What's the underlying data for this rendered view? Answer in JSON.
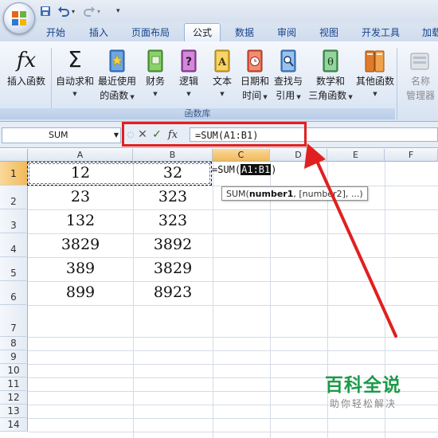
{
  "quick_access": {
    "save": "save-icon",
    "undo": "undo-icon",
    "redo": "redo-icon",
    "customize": "dropdown-icon"
  },
  "tabs": [
    {
      "label": "开始",
      "active": false
    },
    {
      "label": "插入",
      "active": false
    },
    {
      "label": "页面布局",
      "active": false
    },
    {
      "label": "公式",
      "active": true
    },
    {
      "label": "数据",
      "active": false
    },
    {
      "label": "审阅",
      "active": false
    },
    {
      "label": "视图",
      "active": false
    },
    {
      "label": "开发工具",
      "active": false
    },
    {
      "label": "加载",
      "active": false
    }
  ],
  "ribbon": {
    "insert_function": {
      "line1": "插入函数"
    },
    "autosum": {
      "line1": "自动求和"
    },
    "recent": {
      "line1": "最近使用",
      "line2": "的函数"
    },
    "financial": {
      "line1": "财务"
    },
    "logical": {
      "line1": "逻辑"
    },
    "text": {
      "line1": "文本"
    },
    "datetime": {
      "line1": "日期和",
      "line2": "时间"
    },
    "lookup": {
      "line1": "查找与",
      "line2": "引用"
    },
    "math": {
      "line1": "数学和",
      "line2": "三角函数"
    },
    "more": {
      "line1": "其他函数"
    },
    "name_manager": {
      "line1": "名称",
      "line2": "管理器"
    },
    "group_label": "函数库"
  },
  "formula_bar": {
    "name_box": "SUM",
    "formula": "=SUM(A1:B1)",
    "fx": "fx"
  },
  "columns": [
    "A",
    "B",
    "C",
    "D",
    "E",
    "F"
  ],
  "rows": [
    "1",
    "2",
    "3",
    "4",
    "5",
    "6",
    "7",
    "8",
    "9",
    "10",
    "11",
    "12",
    "13",
    "14"
  ],
  "cells": [
    {
      "a": "12",
      "b": "32"
    },
    {
      "a": "23",
      "b": "323"
    },
    {
      "a": "132",
      "b": "323"
    },
    {
      "a": "3829",
      "b": "3892"
    },
    {
      "a": "389",
      "b": "3829"
    },
    {
      "a": "899",
      "b": "8923"
    }
  ],
  "editing": {
    "prefix": "=SUM(",
    "range": "A1:B1",
    "suffix": ")"
  },
  "tooltip": {
    "fn": "SUM(",
    "arg1": "number1",
    "rest": ", [number2], ...)"
  },
  "watermark": {
    "title": "百科全说",
    "subtitle": "助你轻松解决"
  },
  "colors": {
    "annotation_red": "#e02020",
    "selection_orange": "#f2b95a",
    "watermark_green": "#1d9a4a"
  }
}
